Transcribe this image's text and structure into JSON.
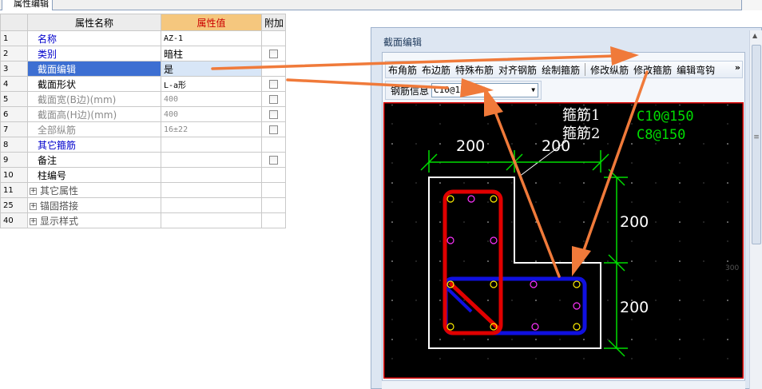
{
  "tab": {
    "label": "属性编辑"
  },
  "grid": {
    "headers": {
      "name": "属性名称",
      "value": "属性值",
      "extra": "附加"
    },
    "rows": [
      {
        "idx": "1",
        "name": "名称",
        "value": "AZ-1",
        "check": false
      },
      {
        "idx": "2",
        "name": "类别",
        "value": "暗柱",
        "check": true
      },
      {
        "idx": "3",
        "name": "截面编辑",
        "value": "是",
        "check": false
      },
      {
        "idx": "4",
        "name": "截面形状",
        "value": "L-a形",
        "check": true
      },
      {
        "idx": "5",
        "name": "截面宽(B边)(mm)",
        "value": "400",
        "check": true
      },
      {
        "idx": "6",
        "name": "截面高(H边)(mm)",
        "value": "400",
        "check": true
      },
      {
        "idx": "7",
        "name": "全部纵筋",
        "value": "16±22",
        "check": true
      },
      {
        "idx": "8",
        "name": "其它箍筋",
        "value": "",
        "check": false
      },
      {
        "idx": "9",
        "name": "备注",
        "value": "",
        "check": true
      },
      {
        "idx": "10",
        "name": "柱编号",
        "value": "",
        "check": false
      },
      {
        "idx": "11",
        "name": "其它属性",
        "value": "",
        "check": false
      },
      {
        "idx": "25",
        "name": "锚固搭接",
        "value": "",
        "check": false
      },
      {
        "idx": "40",
        "name": "显示样式",
        "value": "",
        "check": false
      }
    ]
  },
  "dialog": {
    "title": "截面编辑",
    "toolbar": [
      "布角筋",
      "布边筋",
      "特殊布筋",
      "对齐钢筋",
      "绘制箍筋",
      "修改纵筋",
      "修改箍筋",
      "编辑弯钩"
    ],
    "more": "»",
    "rebar_label": "钢筋信息",
    "rebar_value": "C10@150"
  },
  "drawing": {
    "legend": [
      {
        "label": "箍筋1",
        "value": "C10@150"
      },
      {
        "label": "箍筋2",
        "value": "C8@150"
      }
    ],
    "dims": {
      "top_left": "200",
      "top_right": "200",
      "right_top": "200",
      "right_bottom": "200"
    },
    "edge_label": "300",
    "colors": {
      "background": "#000000",
      "outline": "#ffffff",
      "stirrup1": "#ff0000",
      "stirrup2": "#0000ff",
      "dimension": "#00ff00",
      "arrow": "#f07a3a"
    }
  }
}
